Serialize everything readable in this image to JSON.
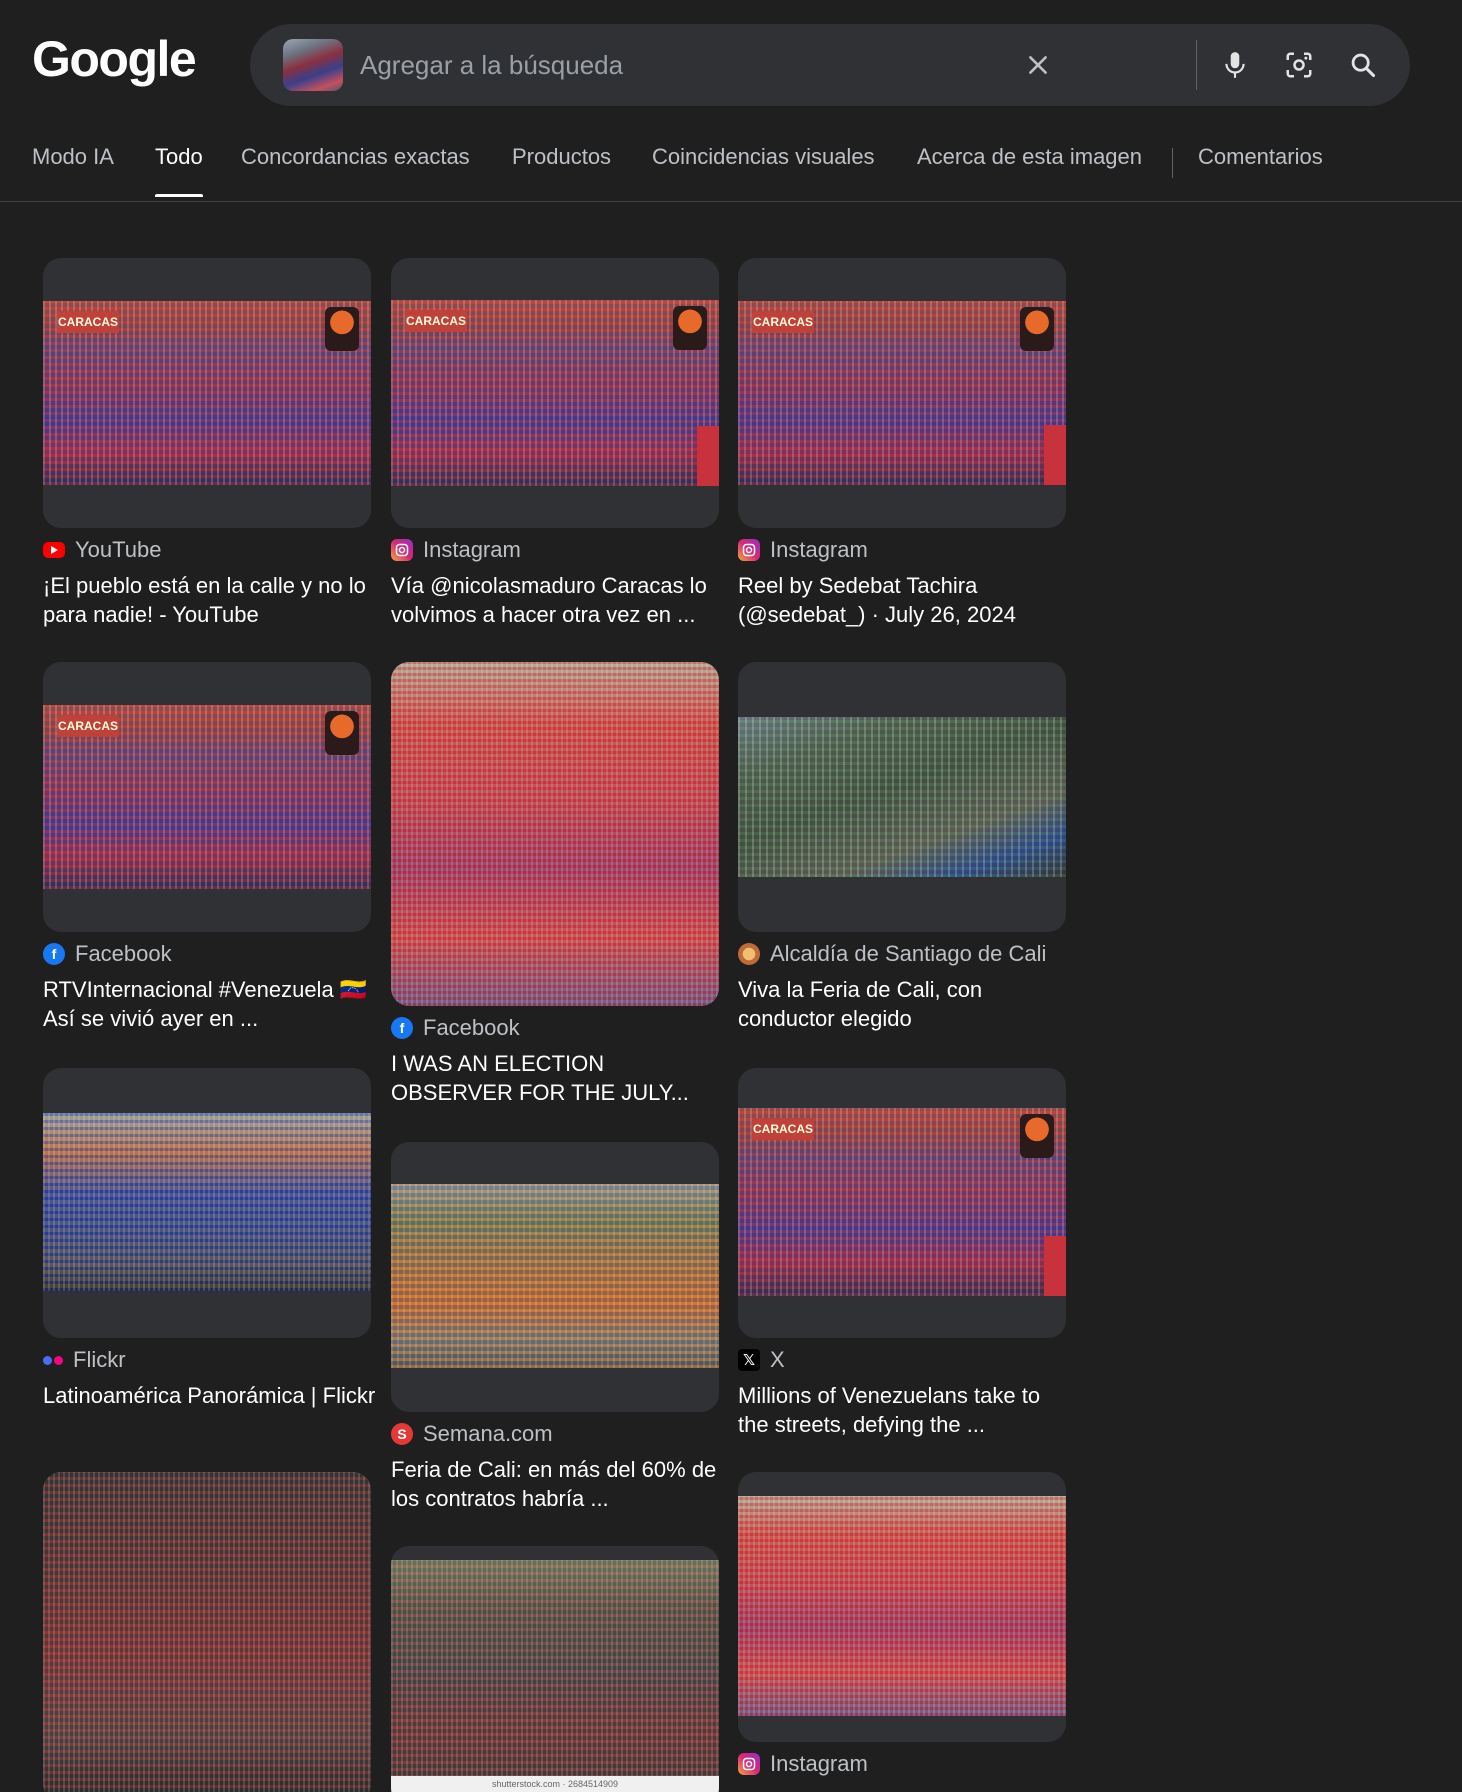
{
  "header": {
    "logo": "Google",
    "search_placeholder": "Agregar a la búsqueda"
  },
  "icons": {
    "clear": "close-icon",
    "voice": "microphone-icon",
    "lens": "camera-lens-icon",
    "search": "search-icon"
  },
  "tabs": [
    {
      "label": "Modo IA"
    },
    {
      "label": "Todo"
    },
    {
      "label": "Concordancias exactas"
    },
    {
      "label": "Productos"
    },
    {
      "label": "Coincidencias visuales"
    },
    {
      "label": "Acerca de esta imagen"
    },
    {
      "label": "Comentarios"
    }
  ],
  "active_tab": "Todo",
  "results": [
    {
      "source": "YouTube",
      "title": "¡El pueblo está en la calle y no lo para nadie! - YouTube"
    },
    {
      "source": "Instagram",
      "title": "Vía @nicolasmaduro Caracas lo volvimos a hacer otra vez en ..."
    },
    {
      "source": "Instagram",
      "title": "Reel by Sedebat Tachira (@sedebat_) · July 26, 2024"
    },
    {
      "source": "Facebook",
      "title": "RTVInternacional #Venezuela 🇻🇪 Así se vivió ayer en ..."
    },
    {
      "source": "Facebook",
      "title": "I WAS AN ELECTION OBSERVER FOR THE JULY..."
    },
    {
      "source": "Alcaldía de Santiago de Cali",
      "title": "Viva la Feria de Cali, con conductor elegido"
    },
    {
      "source": "Flickr",
      "title": "Latinoamérica Panorámica | Flickr"
    },
    {
      "source": "Semana.com",
      "title": "Feria de Cali: en más del 60% de los contratos habría ..."
    },
    {
      "source": "X",
      "title": "Millions of Venezuelans take to the streets, defying the ..."
    },
    {
      "source": "Instagram",
      "title": ""
    }
  ],
  "image_overlay": {
    "banner_text": "CARACAS",
    "watermark": "shutterstock.com · 2684514909"
  },
  "colors": {
    "background": "#1f1f1f",
    "searchbar": "#303134",
    "card": "#303134",
    "youtube": "#ff0000",
    "facebook": "#1877f2",
    "semana": "#e53935"
  }
}
